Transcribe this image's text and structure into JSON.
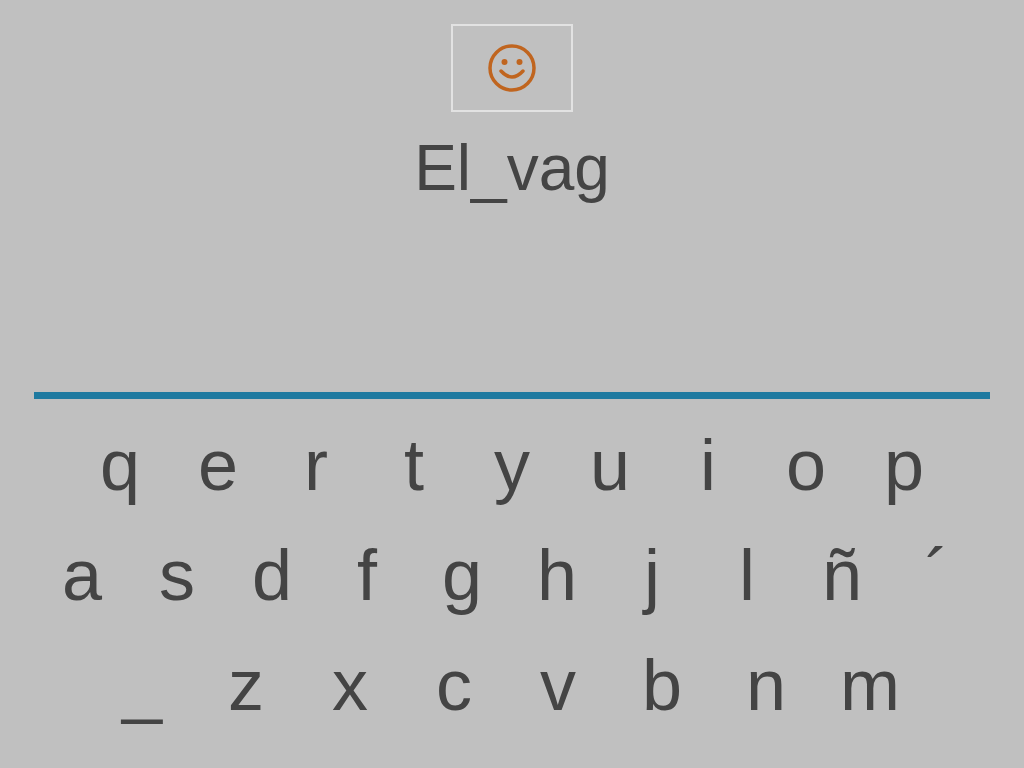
{
  "word": "El_vag",
  "keyboard": {
    "rows": [
      [
        "q",
        "e",
        "r",
        "t",
        "y",
        "u",
        "i",
        "o",
        "p"
      ],
      [
        "a",
        "s",
        "d",
        "f",
        "g",
        "h",
        "j",
        "l",
        "ñ",
        "´"
      ],
      [
        "_",
        "z",
        "x",
        "c",
        "v",
        "b",
        "n",
        "m"
      ]
    ]
  }
}
